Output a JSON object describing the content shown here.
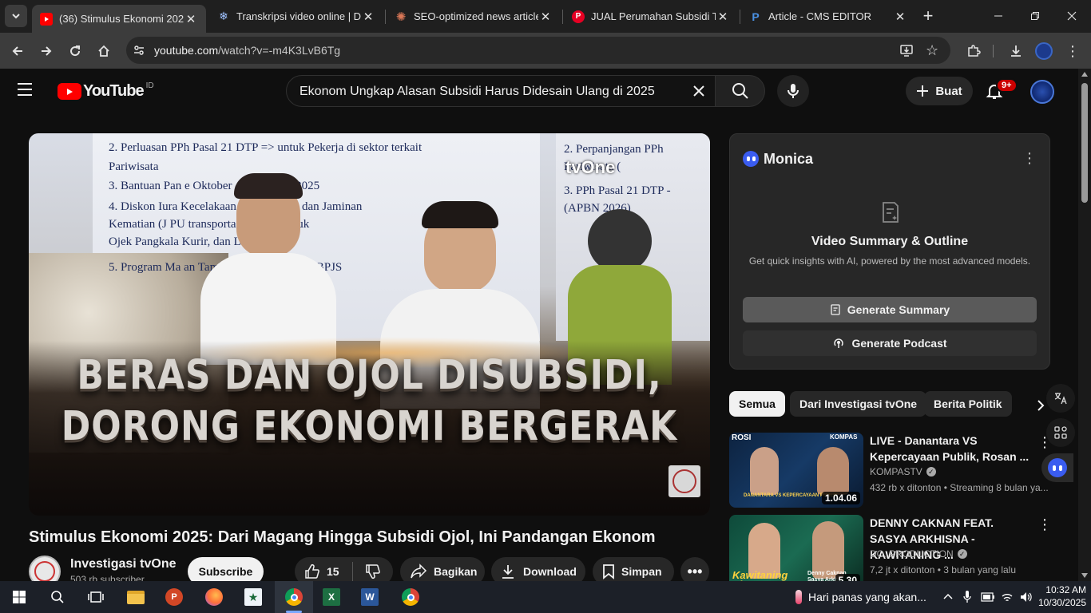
{
  "browser": {
    "tabs": [
      {
        "title": "(36) Stimulus Ekonomi 2025: D",
        "favicon": "youtube-icon",
        "active": true
      },
      {
        "title": "Transkripsi video online | Den",
        "favicon": "transcribe-icon",
        "active": false
      },
      {
        "title": "SEO-optimized news article on",
        "favicon": "claude-icon",
        "active": false
      },
      {
        "title": "JUAL Perumahan Subsidi Type",
        "favicon": "pinterest-icon",
        "active": false
      },
      {
        "title": "Article - CMS EDITOR",
        "favicon": "cms-icon",
        "active": false
      }
    ],
    "url_domain": "youtube.com",
    "url_path": "/watch?v=-m4K3LvB6Tg"
  },
  "youtube": {
    "logo_text": "YouTube",
    "region": "ID",
    "search_query": "Ekonom Ungkap Alasan Subsidi Harus Didesain Ulang di 2025",
    "create_label": "Buat",
    "notif_badge": "9+"
  },
  "video": {
    "slide_lines_left": [
      "2.  Perluasan PPh Pasal 21 DTP => untuk Pekerja di sektor terkait",
      "     Pariwisata",
      "3.  Bantuan Pan        e Oktober - November 2025",
      "4.  Diskon Iura          Kecelakaan Kerja (JKK) dan Jaminan",
      "     Kematian (J         PU transportasi onli         ermasuk",
      "     Ojek Pangkala      Kurir, dan Logistik) se",
      "5.  Program Ma         an Tambahan (MLT) untuk          BPJS"
    ],
    "slide_lines_right": [
      "2.  Perpanjangan PPh",
      "     Pariwisata (",
      "3.  PPh Pasal 21 DTP -",
      "     (APBN 2026)"
    ],
    "channel_watermark": "tvOne",
    "headline_1": "BERAS DAN OJOL DISUBSIDI,",
    "headline_2": "DORONG EKONOMI BERGERAK",
    "title": "Stimulus Ekonomi 2025: Dari Magang Hingga Subsidi Ojol, Ini Pandangan Ekonom",
    "channel_name": "Investigasi tvOne",
    "subscribers": "503 rb subscriber",
    "subscribe_label": "Subscribe",
    "likes": "15",
    "share_label": "Bagikan",
    "download_label": "Download",
    "save_label": "Simpan"
  },
  "monica": {
    "name": "Monica",
    "heading": "Video Summary & Outline",
    "subtext": "Get quick insights with AI, powered by the most advanced models.",
    "summary_btn": "Generate Summary",
    "podcast_btn": "Generate Podcast"
  },
  "chips": [
    "Semua",
    "Dari Investigasi tvOne",
    "Berita Politik"
  ],
  "recommendations": [
    {
      "title": "LIVE - Danantara VS Kepercayaan Publik, Rosan ...",
      "channel": "KOMPASTV",
      "meta": "432 rb x ditonton • Streaming 8 bulan ya...",
      "duration": "1.04.06",
      "thumb_tag": "ROSI",
      "thumb_tag2": "KOMPAS",
      "thumb_caption": "DANANTARA VS KEPERCAYAAN PUBLIK"
    },
    {
      "title": "DENNY CAKNAN FEAT. SASYA ARKHISNA - KAWITANING ...",
      "channel": "DC. PRODUCTION",
      "meta": "7,2 jt x ditonton • 3 bulan yang lalu",
      "duration": "5.30",
      "thumb_caption": "Kawitaning Sinawang",
      "thumb_caption2": "Denny Caknan Sasya Arkh"
    }
  ],
  "taskbar": {
    "weather_text": "Hari panas yang akan...",
    "time": "10:32 AM",
    "date": "10/30/2025"
  },
  "colors": {
    "youtube_red": "#ff0000",
    "bg": "#0f0f0f",
    "chip_bg": "#272727"
  }
}
